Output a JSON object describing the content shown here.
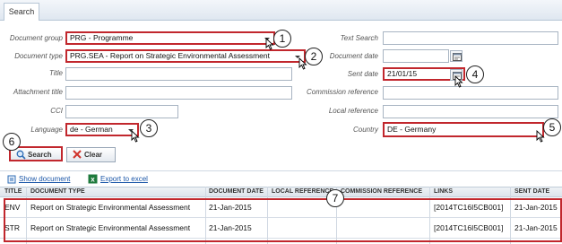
{
  "tab": {
    "label": "Search"
  },
  "form": {
    "document_group": {
      "label": "Document group",
      "value": "PRG - Programme"
    },
    "document_type": {
      "label": "Document type",
      "value": "PRG.SEA - Report on Strategic Environmental Assessment"
    },
    "title": {
      "label": "Title",
      "value": ""
    },
    "attachment_title": {
      "label": "Attachment title",
      "value": ""
    },
    "cci": {
      "label": "CCI",
      "value": ""
    },
    "language": {
      "label": "Language",
      "value": "de - German"
    },
    "text_search": {
      "label": "Text Search",
      "value": ""
    },
    "document_date": {
      "label": "Document date",
      "value": ""
    },
    "sent_date": {
      "label": "Sent date",
      "value": "21/01/15"
    },
    "commission_reference": {
      "label": "Commission reference",
      "value": ""
    },
    "local_reference": {
      "label": "Local reference",
      "value": ""
    },
    "country": {
      "label": "Country",
      "value": "DE - Germany"
    }
  },
  "buttons": {
    "search": "Search",
    "clear": "Clear"
  },
  "links": {
    "show_document": "Show document",
    "export_to_excel": "Export to excel"
  },
  "callouts": [
    "1",
    "2",
    "3",
    "4",
    "5",
    "6",
    "7"
  ],
  "table": {
    "columns": [
      "TITLE",
      "DOCUMENT TYPE",
      "DOCUMENT DATE",
      "LOCAL REFERENCE",
      "COMMISSION REFERENCE",
      "LINKS",
      "SENT DATE"
    ],
    "rows": [
      [
        "ENV",
        "Report on Strategic Environmental Assessment",
        "21-Jan-2015",
        "",
        "",
        "[2014TC16I5CB001]",
        "21-Jan-2015"
      ],
      [
        "STR",
        "Report on Strategic Environmental Assessment",
        "21-Jan-2015",
        "",
        "",
        "[2014TC16I5CB001]",
        "21-Jan-2015"
      ]
    ]
  },
  "colors": {
    "highlight": "#c1272d",
    "link": "#1a56a8"
  }
}
